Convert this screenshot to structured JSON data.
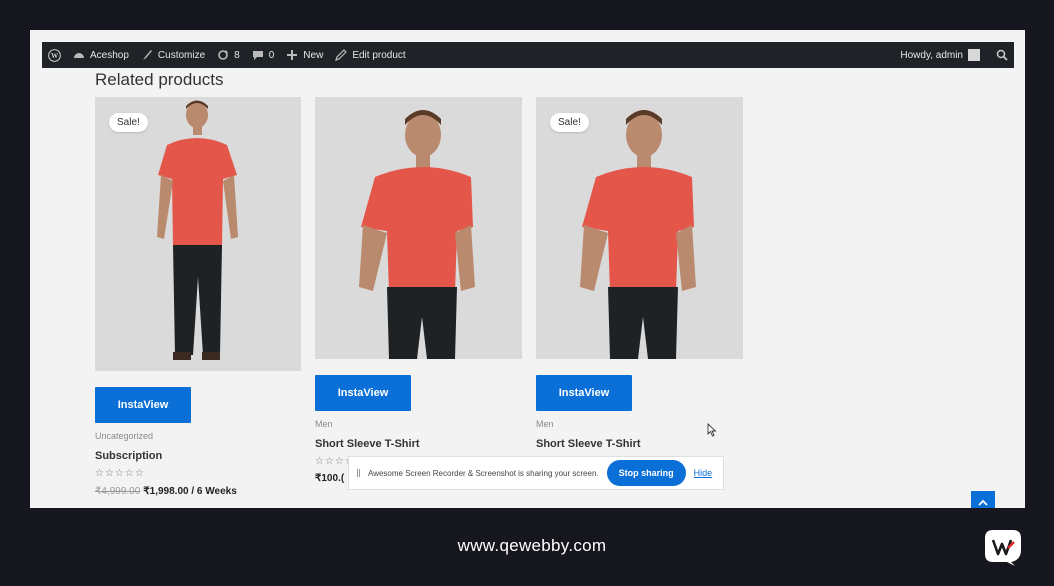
{
  "adminbar": {
    "site_name": "Aceshop",
    "customize": "Customize",
    "updates_count": "8",
    "comments_count": "0",
    "new_label": "New",
    "edit_label": "Edit product",
    "howdy": "Howdy, admin"
  },
  "section_title": "Related products",
  "products": [
    {
      "badge": "Sale!",
      "button": "InstaView",
      "category": "Uncategorized",
      "name": "Subscription",
      "rating": "☆☆☆☆☆",
      "old_price": "₹4,999.00",
      "price": "₹1,998.00 / 6 Weeks"
    },
    {
      "badge": "",
      "button": "InstaView",
      "category": "Men",
      "name": "Short Sleeve T-Shirt",
      "rating": "☆☆☆☆☆",
      "old_price": "",
      "price": "₹100.("
    },
    {
      "badge": "Sale!",
      "button": "InstaView",
      "category": "Men",
      "name": "Short Sleeve T-Shirt",
      "rating": "☆☆☆☆☆",
      "old_price": "",
      "price": ""
    }
  ],
  "share_bar": {
    "message": "Awesome Screen Recorder & Screenshot is sharing your screen.",
    "stop_label": "Stop sharing",
    "hide_label": "Hide"
  },
  "footer": {
    "url": "www.qewebby.com"
  },
  "colors": {
    "accent": "#0b6fd8",
    "tshirt": "#e5564a",
    "admin_bar": "#1f2327",
    "outer_bg": "#16161e"
  }
}
